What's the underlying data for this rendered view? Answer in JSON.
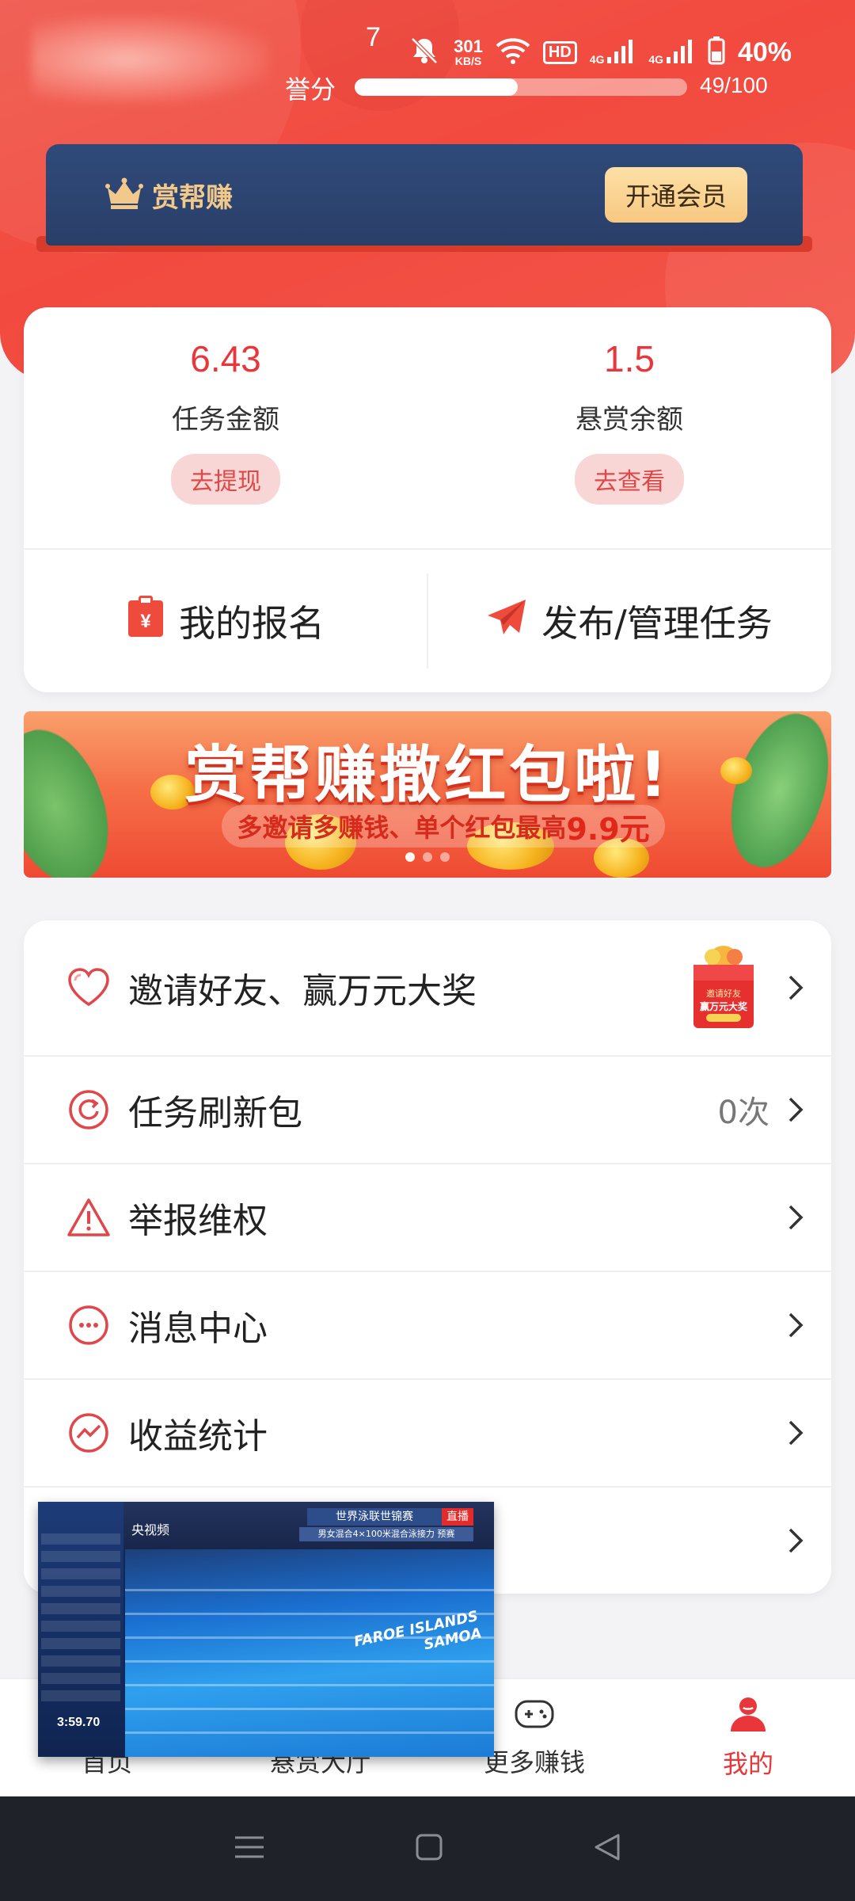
{
  "status_bar": {
    "user_id_fragment": "7",
    "net_speed_value": "301",
    "net_speed_unit": "KB/S",
    "hd_badge": "HD",
    "signal_1": "4G",
    "signal_2": "4G",
    "battery": "40%"
  },
  "reputation": {
    "label": "誉分",
    "value_text": "49/100",
    "progress": 0.49
  },
  "vip": {
    "brand": "赏帮赚",
    "button": "开通会员",
    "brand_color": "#f2c98a"
  },
  "stats": {
    "task_amount": {
      "value": "6.43",
      "label": "任务金额",
      "action": "去提现"
    },
    "reward_balance": {
      "value": "1.5",
      "label": "悬赏余额",
      "action": "去查看"
    }
  },
  "quick_actions": {
    "my_signup": "我的报名",
    "publish": "发布/管理任务"
  },
  "banner": {
    "title": "赏帮赚撒红包啦!",
    "subtitle_prefix": "多邀请多赚钱、单个红包最高",
    "subtitle_highlight": "9.9元"
  },
  "menu": {
    "invite": {
      "label": "邀请好友、赢万元大奖",
      "gift_lines": [
        "邀请好友",
        "赢万元大奖"
      ]
    },
    "refresh": {
      "label": "任务刷新包",
      "extra": "0次"
    },
    "report": {
      "label": "举报维权"
    },
    "messages": {
      "label": "消息中心"
    },
    "earnings": {
      "label": "收益统计"
    }
  },
  "bottom_nav": {
    "home": "首页",
    "hall": "悬赏大厅",
    "more": "更多赚钱",
    "mine": "我的"
  },
  "video": {
    "channel": "央视频",
    "event_title": "世界泳联世锦赛",
    "event_sub": "男女混合4×100米混合泳接力 预赛",
    "live": "直播",
    "names": [
      "FAROE ISLANDS",
      "SAMOA"
    ],
    "time": "3:59.70"
  },
  "colors": {
    "accent": "#e8363a",
    "header": "#f24a3f"
  }
}
